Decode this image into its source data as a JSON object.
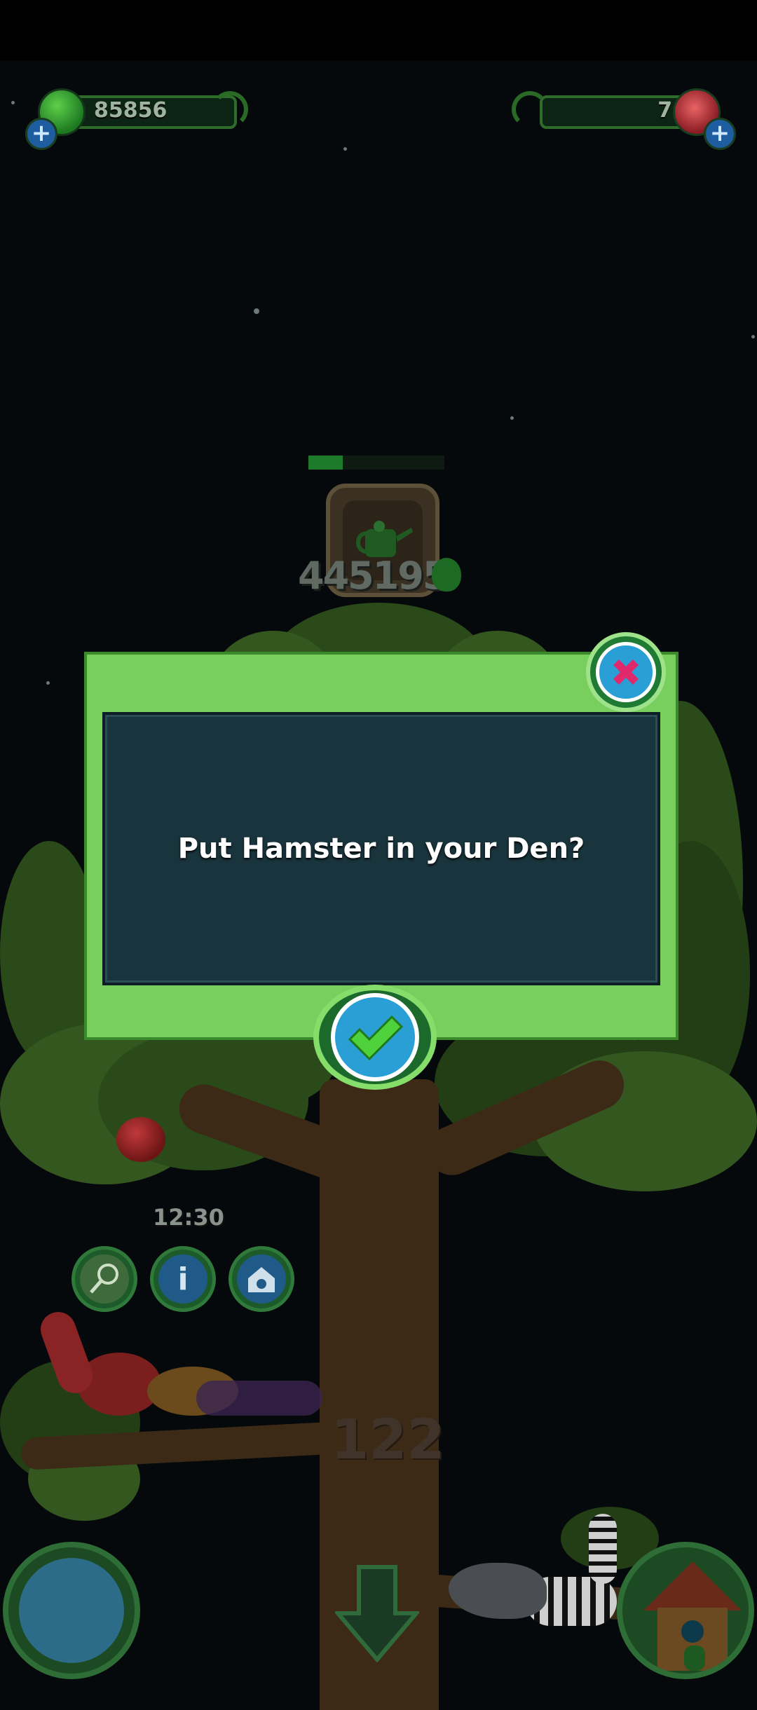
{
  "hud": {
    "seeds": "85856",
    "gems": "74"
  },
  "tree": {
    "tool_score": "445195",
    "tool_progress": 0.25,
    "timer": "12:30",
    "level": "122"
  },
  "dialog": {
    "message": "Put Hamster in your Den?"
  },
  "colors": {
    "dialog_frame": "#79cf5e",
    "dialog_panel": "#19343d",
    "button_blue": "#2a9fd6",
    "close_pink": "#e0286c",
    "confirm_green": "#4fd13b"
  },
  "icons": {
    "seed": "green-seed-icon",
    "gem": "red-crystal-icon",
    "plus": "plus-icon",
    "tool": "watering-can-icon",
    "close": "close-x-icon",
    "confirm": "checkmark-icon",
    "net": "net-icon",
    "info": "info-icon",
    "den": "den-house-icon",
    "globe": "globe-icon",
    "down": "down-arrow-icon"
  }
}
